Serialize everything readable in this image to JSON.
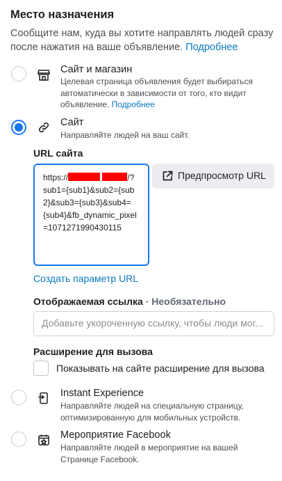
{
  "section": {
    "title": "Место назначения",
    "description": "Сообщите нам, куда вы хотите направлять людей сразу после нажатия на ваше объявление.",
    "more_link": "Подробнее"
  },
  "options": {
    "site_and_shop": {
      "title": "Сайт и магазин",
      "description": "Целевая страница объявления будет выбираться автоматически в зависимости от того, кто видит объявление.",
      "more_link": "Подробнее",
      "icon": "storefront-icon",
      "selected": false
    },
    "website": {
      "title": "Сайт",
      "description": "Направляйте людей на ваш сайт.",
      "icon": "link-icon",
      "selected": true
    },
    "instant_experience": {
      "title": "Instant Experience",
      "description": "Направляйте людей на специальную страницу, оптимизированную для мобильных устройств.",
      "icon": "mobile-document-icon",
      "selected": false
    },
    "facebook_event": {
      "title": "Мероприятие Facebook",
      "description": "Направляйте людей в мероприятие на вашей Странице Facebook.",
      "icon": "calendar-star-icon",
      "selected": false
    }
  },
  "url_field": {
    "label": "URL сайта",
    "value_prefix": "https://",
    "value_mid": "/?sub1=",
    "value_rest": "{sub1}&sub2={sub2}&sub3={sub3}&sub4={sub4}&fb_dynamic_pixel=1071271990430115",
    "redaction_color": "#ff0000"
  },
  "preview_button": {
    "label": "Предпросмотр URL",
    "icon": "external-open-icon"
  },
  "create_param_link": "Создать параметр URL",
  "display_link": {
    "label": "Отображаемая ссылка",
    "separator": " · ",
    "optional": "Необязательно",
    "placeholder": "Добавьте укороченную ссылку, чтобы люди мог...",
    "value": ""
  },
  "call_extension": {
    "label": "Расширение для вызова",
    "checkbox_label": "Показывать на сайте расширение для вызова",
    "checked": false
  },
  "colors": {
    "accent": "#1877f2",
    "link": "#0a78be"
  }
}
